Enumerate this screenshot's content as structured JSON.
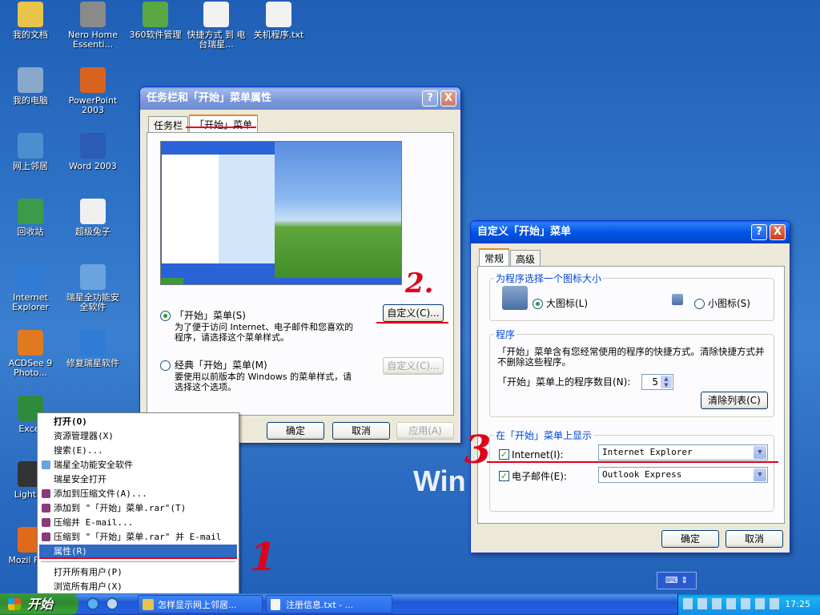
{
  "desktop": {
    "icons": [
      {
        "label": "我的文档",
        "icon": "my-documents-icon",
        "color": "#e8c44a"
      },
      {
        "label": "Nero Home Essenti...",
        "icon": "nero-icon",
        "color": "#8a8a8a"
      },
      {
        "label": "360软件管理",
        "icon": "360-icon",
        "color": "#5aa843"
      },
      {
        "label": "快捷方式 到 电台瑞星...",
        "icon": "text-file-icon",
        "color": "#f2f2f2"
      },
      {
        "label": "关机程序.txt",
        "icon": "text-file-icon",
        "color": "#f2f2f2"
      },
      {
        "label": "我的电脑",
        "icon": "my-computer-icon",
        "color": "#8aa7cc"
      },
      {
        "label": "PowerPoint 2003",
        "icon": "powerpoint-icon",
        "color": "#d8631e"
      },
      {
        "label": "网上邻居",
        "icon": "network-places-icon",
        "color": "#4a8fd0"
      },
      {
        "label": "Word 2003",
        "icon": "word-icon",
        "color": "#2b5bb5"
      },
      {
        "label": "回收站",
        "icon": "recycle-bin-icon",
        "color": "#3b9b4b"
      },
      {
        "label": "超级兔子",
        "icon": "rabbit-icon",
        "color": "#f0f0f0"
      },
      {
        "label": "Internet Explorer",
        "icon": "ie-icon",
        "color": "#2f7bd6"
      },
      {
        "label": "瑞星全功能安全软件",
        "icon": "rising-icon",
        "color": "#6aa3e0"
      },
      {
        "label": "ACDSee 9 Photo...",
        "icon": "acdsee-icon",
        "color": "#e07a20"
      },
      {
        "label": "修复瑞星软件",
        "icon": "ie-icon",
        "color": "#2f7bd6"
      },
      {
        "label": "Excel",
        "icon": "excel-icon",
        "color": "#2e8b3e"
      },
      {
        "label": "LightSc",
        "icon": "lightscribe-icon",
        "color": "#333333"
      },
      {
        "label": "Mozil Firef",
        "icon": "firefox-icon",
        "color": "#e06a1a"
      }
    ],
    "watermark": "Win"
  },
  "taskbar_props": {
    "title": "任务栏和「开始」菜单属性",
    "help": "?",
    "close": "X",
    "tabs": [
      "任务栏",
      "「开始」菜单"
    ],
    "radio_start_label": "「开始」菜单(S)",
    "radio_start_desc": "为了便于访问 Internet、电子邮件和您喜欢的程序，请选择这个菜单样式。",
    "radio_classic_label": "经典「开始」菜单(M)",
    "radio_classic_desc": "要使用以前版本的 Windows 的菜单样式，请选择这个选项。",
    "customize1": "自定义(C)...",
    "customize2": "自定义(C)...",
    "ok": "确定",
    "cancel": "取消",
    "apply": "应用(A)"
  },
  "customize": {
    "title": "自定义「开始」菜单",
    "help": "?",
    "close": "X",
    "tabs": [
      "常规",
      "高级"
    ],
    "icon_group": "为程序选择一个图标大小",
    "large_icons": "大图标(L)",
    "small_icons": "小图标(S)",
    "programs_group": "程序",
    "programs_desc": "「开始」菜单含有您经常使用的程序的快捷方式。清除快捷方式并不删除这些程序。",
    "count_label": "「开始」菜单上的程序数目(N):",
    "count_value": "5",
    "clear_list": "清除列表(C)",
    "show_group": "在「开始」菜单上显示",
    "internet_label": "Internet(I):",
    "internet_value": "Internet Explorer",
    "email_label": "电子邮件(E):",
    "email_value": "Outlook Express",
    "ok": "确定",
    "cancel": "取消"
  },
  "context_menu": {
    "items": [
      {
        "label": "打开(O)",
        "bold": true
      },
      {
        "label": "资源管理器(X)"
      },
      {
        "label": "搜索(E)..."
      },
      {
        "label": "瑞星全功能安全软件",
        "icon": "#6aa3e0"
      },
      {
        "label": "瑞星安全打开"
      },
      {
        "label": "添加到压缩文件(A)...",
        "icon": "#8b3a7a"
      },
      {
        "label": "添加到 \"「开始」菜单.rar\"(T)",
        "icon": "#8b3a7a"
      },
      {
        "label": "压缩并 E-mail...",
        "icon": "#8b3a7a"
      },
      {
        "label": "压缩到 \"「开始」菜单.rar\" 并 E-mail",
        "icon": "#8b3a7a"
      },
      {
        "label": "属性(R)",
        "selected": true
      },
      {
        "label": "打开所有用户(P)"
      },
      {
        "label": "浏览所有用户(X)"
      }
    ]
  },
  "annotations": {
    "a1": "1",
    "a2": "2.",
    "a3": "3"
  },
  "taskbar": {
    "start": "开始",
    "tasks": [
      "怎样显示网上邻居...",
      "注册信息.txt - ..."
    ],
    "clock": "17:25"
  },
  "colors": {
    "xp_blue": "#0055e5",
    "annotation_red": "#e0001a",
    "selection": "#316ac5"
  }
}
